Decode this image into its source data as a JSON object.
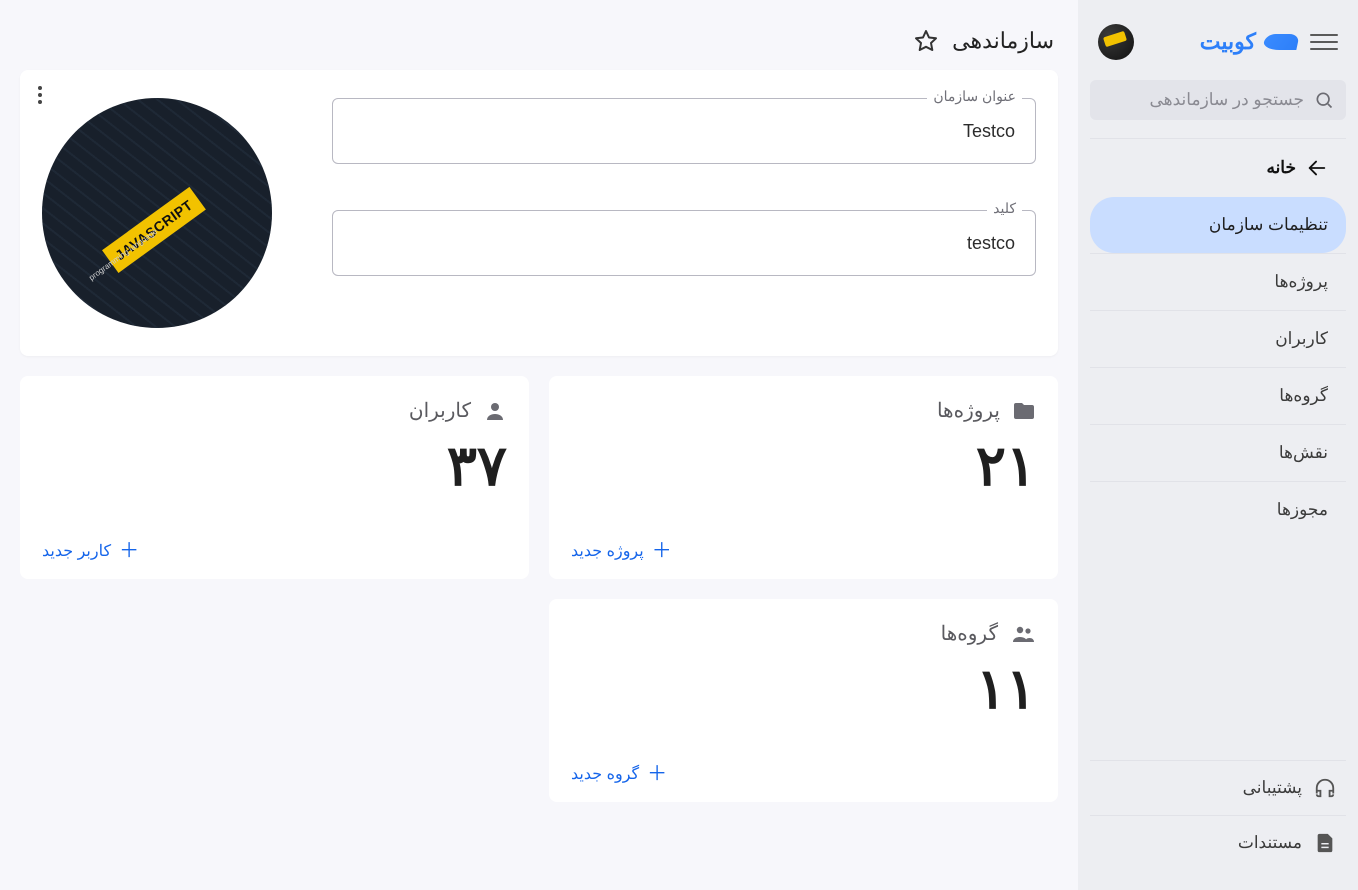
{
  "header": {
    "brand": "کوبیت"
  },
  "search": {
    "placeholder": "جستجو در سازماندهی"
  },
  "nav": {
    "home": "خانه",
    "org_settings": "تنظیمات سازمان",
    "projects": "پروژه‌ها",
    "users": "کاربران",
    "groups": "گروه‌ها",
    "roles": "نقش‌ها",
    "permissions": "مجوزها"
  },
  "footer": {
    "support": "پشتیبانی",
    "docs": "مستندات"
  },
  "page": {
    "title": "سازماندهی"
  },
  "form": {
    "org_title_label": "عنوان سازمان",
    "org_title_value": "Testco",
    "key_label": "کلید",
    "key_value": "testco"
  },
  "avatar": {
    "tag_text": "JAVASCRIPT",
    "sub_text": "programming language"
  },
  "stats": {
    "projects": {
      "label": "پروژه‌ها",
      "value": "۲۱",
      "action": "پروژه جدید"
    },
    "users": {
      "label": "کاربران",
      "value": "۳۷",
      "action": "کاربر جدید"
    },
    "groups": {
      "label": "گروه‌ها",
      "value": "۱۱",
      "action": "گروه جدید"
    }
  }
}
